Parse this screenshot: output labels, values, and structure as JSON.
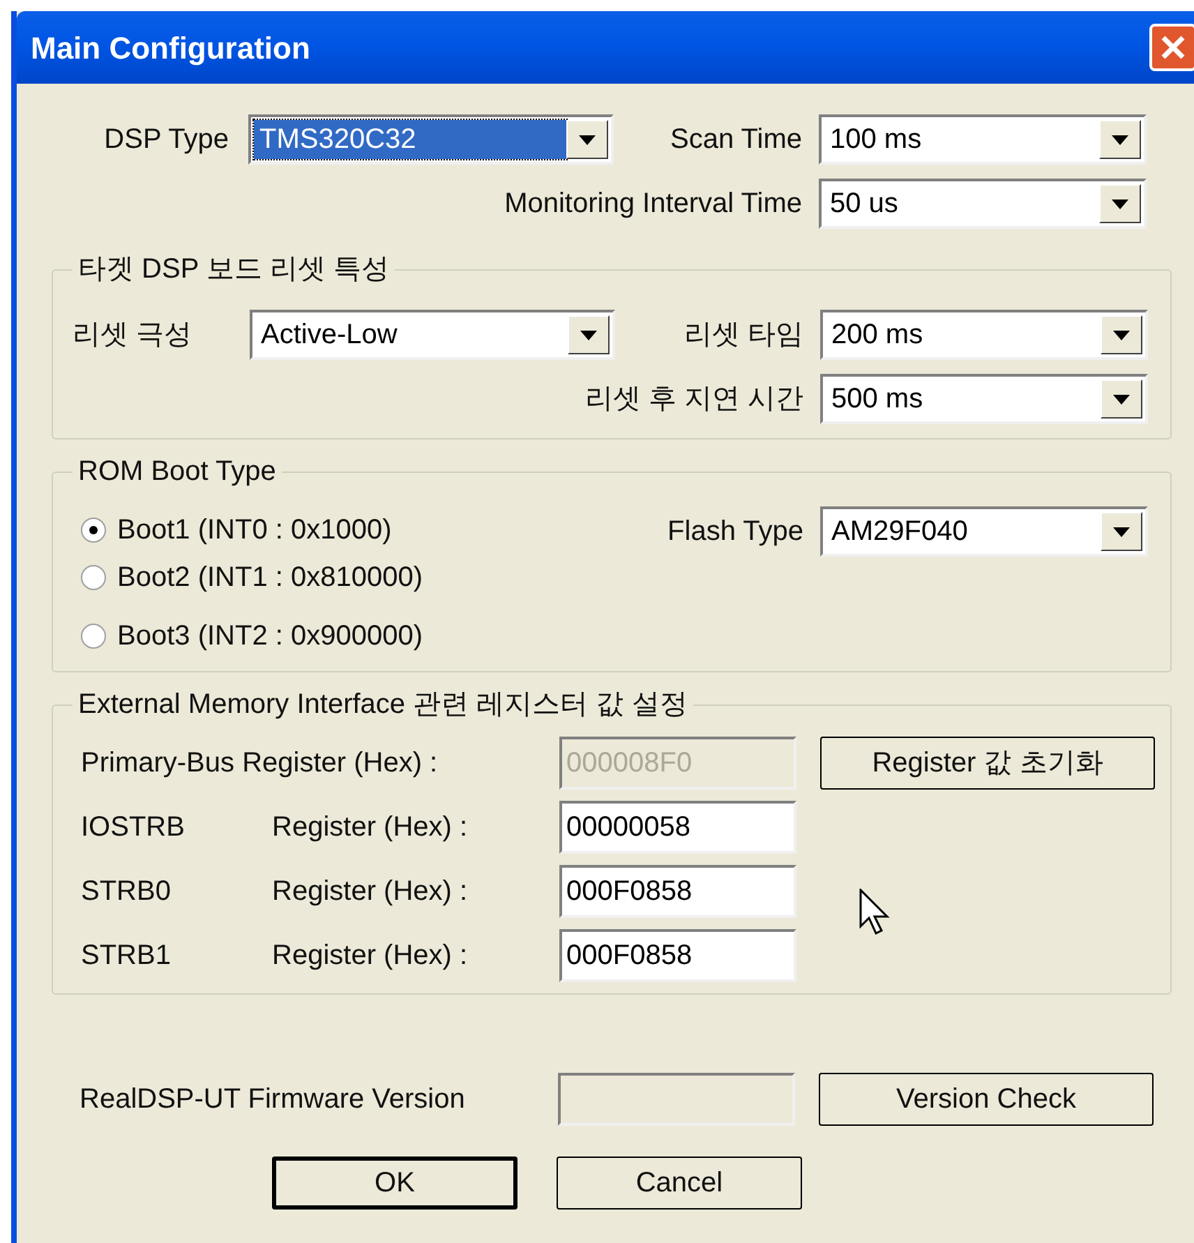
{
  "window": {
    "title": "Main Configuration"
  },
  "general": {
    "dsp_type": {
      "label": "DSP Type",
      "value": "TMS320C32",
      "focused": true
    },
    "scan_time": {
      "label": "Scan Time",
      "value": "100 ms",
      "focused": false
    },
    "monitoring_interval": {
      "label": "Monitoring Interval Time",
      "value": "50 us",
      "focused": false
    }
  },
  "reset_group": {
    "title": "타겟 DSP 보드 리셋 특성",
    "polarity": {
      "label": "리셋 극성",
      "value": "Active-Low",
      "focused": false
    },
    "reset_time": {
      "label": "리셋 타임",
      "value": "200 ms",
      "focused": false
    },
    "delay": {
      "label": "리셋 후 지연 시간",
      "value": "500 ms",
      "focused": false
    }
  },
  "rom_boot": {
    "title": "ROM Boot Type",
    "options": [
      {
        "label": "Boot1 (INT0 : 0x1000)",
        "selected": true
      },
      {
        "label": "Boot2 (INT1 : 0x810000)",
        "selected": false
      },
      {
        "label": "Boot3 (INT2 : 0x900000)",
        "selected": false
      }
    ],
    "flash_type": {
      "label": "Flash Type",
      "value": "AM29F040",
      "focused": false
    }
  },
  "emi": {
    "title": "External Memory Interface  관련 레지스터 값 설정",
    "reset_button": "Register 값 초기화",
    "registers": [
      {
        "name": "Primary-Bus Register (Hex) :",
        "value": "000008F0",
        "disabled": true
      },
      {
        "name": "IOSTRB",
        "label": "Register (Hex) :",
        "value": "00000058",
        "disabled": false
      },
      {
        "name": "STRB0",
        "label": "Register (Hex) :",
        "value": "000F0858",
        "disabled": false
      },
      {
        "name": "STRB1",
        "label": "Register (Hex) :",
        "value": "000F0858",
        "disabled": false
      }
    ]
  },
  "firmware": {
    "label": "RealDSP-UT Firmware Version",
    "button": "Version Check"
  },
  "buttons": [
    {
      "label": "OK",
      "default": true
    },
    {
      "label": "Cancel",
      "default": false
    }
  ]
}
